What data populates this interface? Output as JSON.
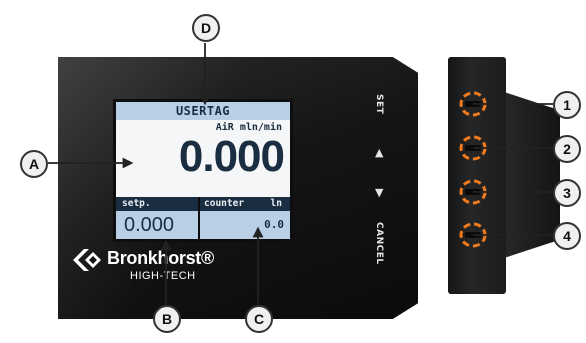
{
  "screen": {
    "title": "USERTAG",
    "units": "AiR mln/min",
    "main_value": "0.000",
    "setpoint_label": "setp.",
    "setpoint_value": "0.000",
    "counter_label": "counter",
    "counter_unit": "ln",
    "counter_value": "0.0"
  },
  "buttons": {
    "set_label": "SET",
    "up_symbol": "▲",
    "down_symbol": "▼",
    "cancel_label": "CANCEL"
  },
  "logo": {
    "name": "Bronkhorst®",
    "subtitle": "HIGH-TECH"
  },
  "callouts": {
    "letters": [
      "A",
      "B",
      "C",
      "D"
    ],
    "numbers": [
      "1",
      "2",
      "3",
      "4"
    ]
  },
  "colors": {
    "screen_bg": "#f4f6f8",
    "title_bar": "#b8cfe6",
    "bottom_bar": "#1b2d40",
    "button_ring": "#f07a1e",
    "device_body": "#141414"
  }
}
